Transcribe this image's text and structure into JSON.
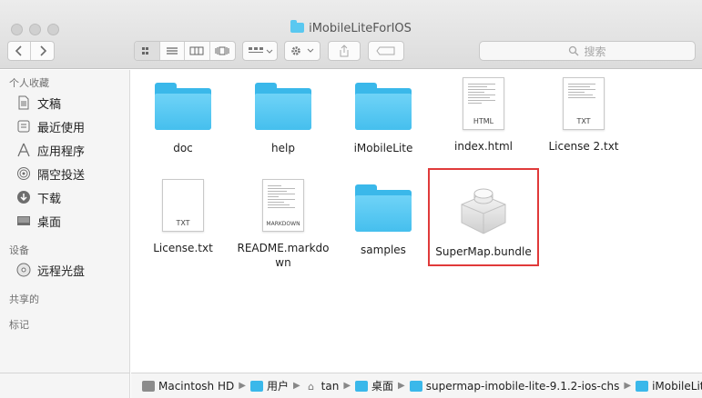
{
  "window": {
    "title": "iMobileLiteForIOS"
  },
  "toolbar": {
    "back_icon": "chevron-left-icon",
    "forward_icon": "chevron-right-icon",
    "view_modes": [
      "icon-view-icon",
      "list-view-icon",
      "column-view-icon",
      "cover-flow-icon"
    ],
    "search_placeholder": "搜索"
  },
  "sidebar": {
    "favorites_header": "个人收藏",
    "favorites": [
      {
        "label": "文稿",
        "icon": "document-icon"
      },
      {
        "label": "最近使用",
        "icon": "clock-icon"
      },
      {
        "label": "应用程序",
        "icon": "applications-icon"
      },
      {
        "label": "隔空投送",
        "icon": "airdrop-icon"
      },
      {
        "label": "下载",
        "icon": "download-icon"
      },
      {
        "label": "桌面",
        "icon": "desktop-icon"
      }
    ],
    "devices_header": "设备",
    "devices": [
      {
        "label": "远程光盘",
        "icon": "disc-icon"
      }
    ],
    "shared_header": "共享的",
    "tags_header": "标记"
  },
  "files": [
    {
      "name": "doc",
      "kind": "folder"
    },
    {
      "name": "help",
      "kind": "folder"
    },
    {
      "name": "iMobileLite",
      "kind": "folder"
    },
    {
      "name": "index.html",
      "kind": "document",
      "ext": "HTML"
    },
    {
      "name": "License 2.txt",
      "kind": "document",
      "ext": "TXT"
    },
    {
      "name": "License.txt",
      "kind": "document",
      "ext": "TXT"
    },
    {
      "name": "README.markdown",
      "kind": "document",
      "ext": "MARKDOWN"
    },
    {
      "name": "samples",
      "kind": "folder"
    },
    {
      "name": "SuperMap.bundle",
      "kind": "bundle"
    }
  ],
  "readme_label": {
    "line1": "README.markdo",
    "line2": "wn"
  },
  "pathbar": [
    {
      "label": "Macintosh HD",
      "icon": "hard-drive-icon"
    },
    {
      "label": "用户",
      "icon": "folder-icon"
    },
    {
      "label": "tan",
      "icon": "home-icon"
    },
    {
      "label": "桌面",
      "icon": "folder-icon"
    },
    {
      "label": "supermap-imobile-lite-9.1.2-ios-chs",
      "icon": "folder-icon"
    },
    {
      "label": "iMobileLiteForIOS",
      "icon": "folder-icon"
    }
  ],
  "highlight_color": "#e03a3a",
  "folder_color": "#3ab8ea"
}
